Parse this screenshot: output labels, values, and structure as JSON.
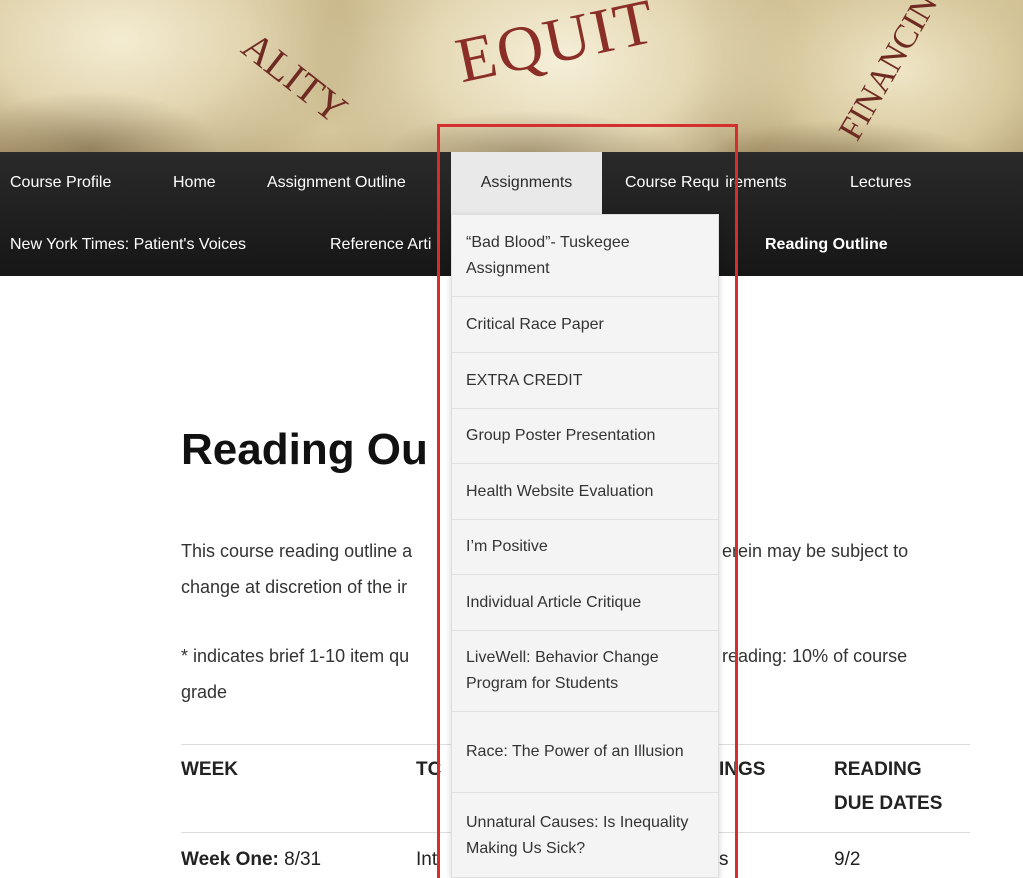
{
  "banner": {
    "words": {
      "quality": "ALITY",
      "equity": "EQUIT",
      "financing": "FINANCIN"
    }
  },
  "nav": {
    "row1": {
      "course_profile": "Course Profile",
      "home": "Home",
      "assignment_outline": "Assignment Outline",
      "assignments": "Assignments",
      "course_requirements": "Course Requ",
      "course_requirements_tail": "irements",
      "lectures": "Lectures"
    },
    "row2": {
      "nyt_voices": "New York Times: Patient's Voices",
      "reference_articles": "Reference Arti",
      "reading_outline": "Reading Outline"
    }
  },
  "dropdown": {
    "items": [
      "“Bad Blood”- Tuskegee Assignment",
      "Critical Race Paper",
      "EXTRA CREDIT",
      "Group Poster Presentation",
      "Health Website Evaluation",
      "I’m Positive",
      "Individual Article Critique",
      "LiveWell: Behavior Change Program for Students",
      "Race: The Power of an Illusion",
      "Unnatural Causes: Is Inequality Making Us Sick?"
    ]
  },
  "page": {
    "title": "Reading Ou",
    "p1_left": "This course reading outline a",
    "p1_right": "erein may be subject to",
    "p1_line2": "change at discretion of the ir",
    "p2_left": "* indicates brief 1-10 item qu",
    "p2_right": "reading: 10% of course",
    "p2_line2": "grade"
  },
  "table": {
    "headers": {
      "week": "WEEK",
      "topic": "TC",
      "readings": "INGS",
      "due_line1": "READING",
      "due_line2": "DUE DATES"
    },
    "rows": [
      {
        "week_label": "Week One:",
        "week_date": " 8/31",
        "topic": "Int",
        "readings": "s",
        "due": "9/2"
      }
    ]
  }
}
